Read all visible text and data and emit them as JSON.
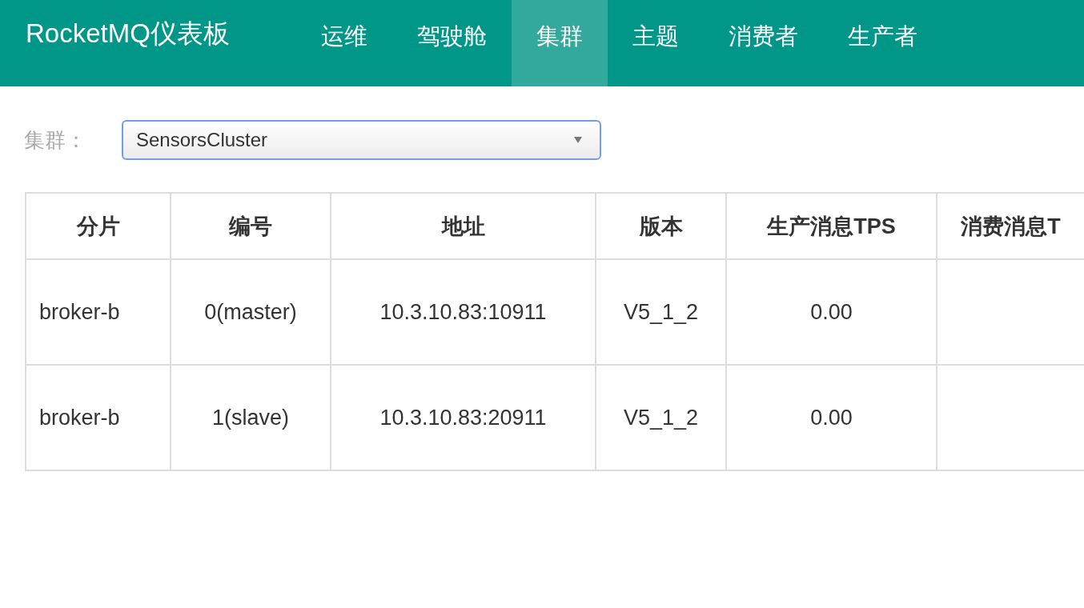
{
  "navbar": {
    "brand": "RocketMQ仪表板",
    "items": [
      {
        "label": "运维",
        "selected": false
      },
      {
        "label": "驾驶舱",
        "selected": false
      },
      {
        "label": "集群",
        "selected": true
      },
      {
        "label": "主题",
        "selected": false
      },
      {
        "label": "消费者",
        "selected": false
      },
      {
        "label": "生产者",
        "selected": false
      }
    ]
  },
  "cluster_filter": {
    "label": "集群：",
    "value": "SensorsCluster"
  },
  "table": {
    "columns": [
      "分片",
      "编号",
      "地址",
      "版本",
      "生产消息TPS",
      "消费消息T"
    ],
    "rows": [
      [
        "broker-b",
        "0(master)",
        "10.3.10.83:10911",
        "V5_1_2",
        "0.00",
        ""
      ],
      [
        "broker-b",
        "1(slave)",
        "10.3.10.83:20911",
        "V5_1_2",
        "0.00",
        ""
      ]
    ]
  }
}
